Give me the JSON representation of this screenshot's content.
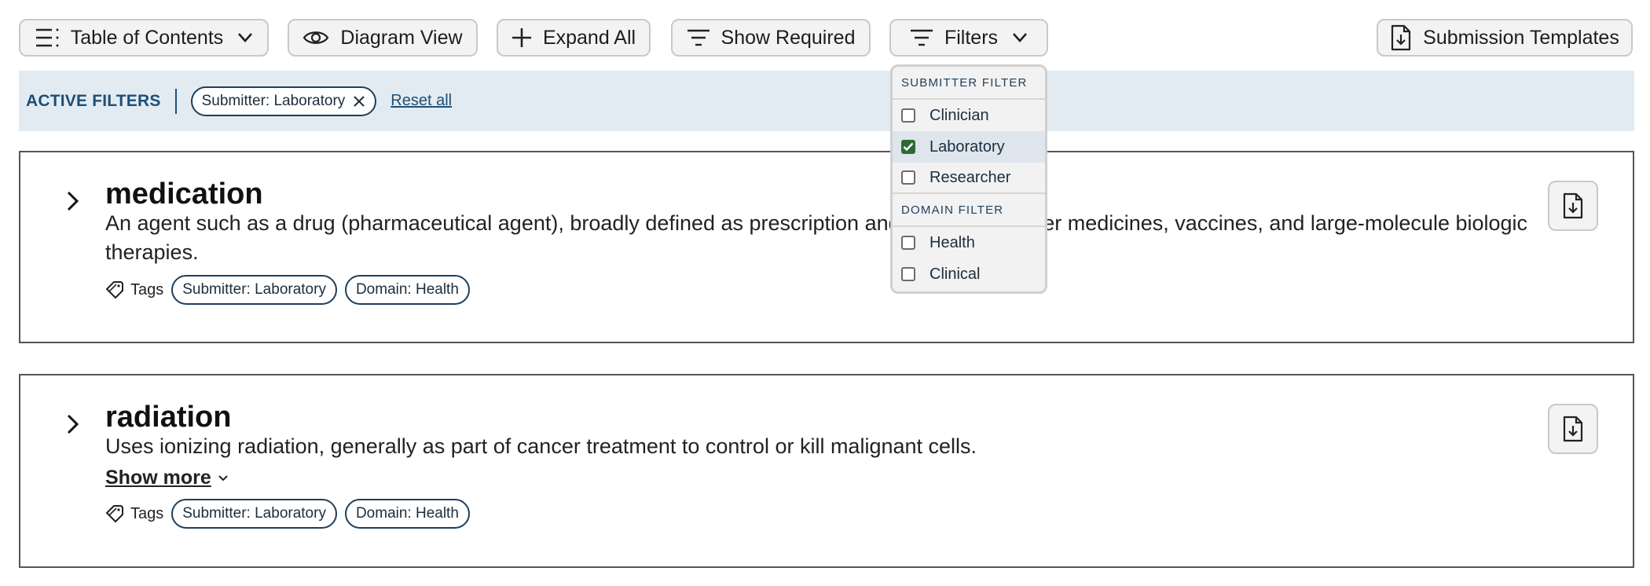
{
  "toolbar": {
    "toc_label": "Table of Contents",
    "diagram_label": "Diagram View",
    "expand_label": "Expand All",
    "required_label": "Show Required",
    "filters_label": "Filters",
    "templates_label": "Submission Templates"
  },
  "active_filters": {
    "title": "ACTIVE FILTERS",
    "chips": [
      "Submitter: Laboratory"
    ],
    "reset_label": "Reset all"
  },
  "filters_dropdown": {
    "groups": [
      {
        "heading": "SUBMITTER FILTER",
        "options": [
          {
            "label": "Clinician",
            "checked": false
          },
          {
            "label": "Laboratory",
            "checked": true
          },
          {
            "label": "Researcher",
            "checked": false
          }
        ]
      },
      {
        "heading": "DOMAIN FILTER",
        "options": [
          {
            "label": "Health",
            "checked": false
          },
          {
            "label": "Clinical",
            "checked": false
          }
        ]
      }
    ]
  },
  "cards": [
    {
      "title": "medication",
      "description": "An agent such as a drug (pharmaceutical agent), broadly defined as prescription and over-the-counter medicines, vaccines, and large-molecule biologic therapies.",
      "tags_label": "Tags",
      "tags": [
        "Submitter: Laboratory",
        "Domain: Health"
      ]
    },
    {
      "title": "radiation",
      "description": "Uses ionizing radiation, generally as part of cancer treatment to control or kill malignant cells.",
      "show_more_label": "Show more",
      "tags_label": "Tags",
      "tags": [
        "Submitter: Laboratory",
        "Domain: Health"
      ]
    }
  ],
  "colors": {
    "accent": "#1d4f76",
    "filter_bar_bg": "#e3ebf2",
    "checkbox_checked": "#2e6b33"
  }
}
